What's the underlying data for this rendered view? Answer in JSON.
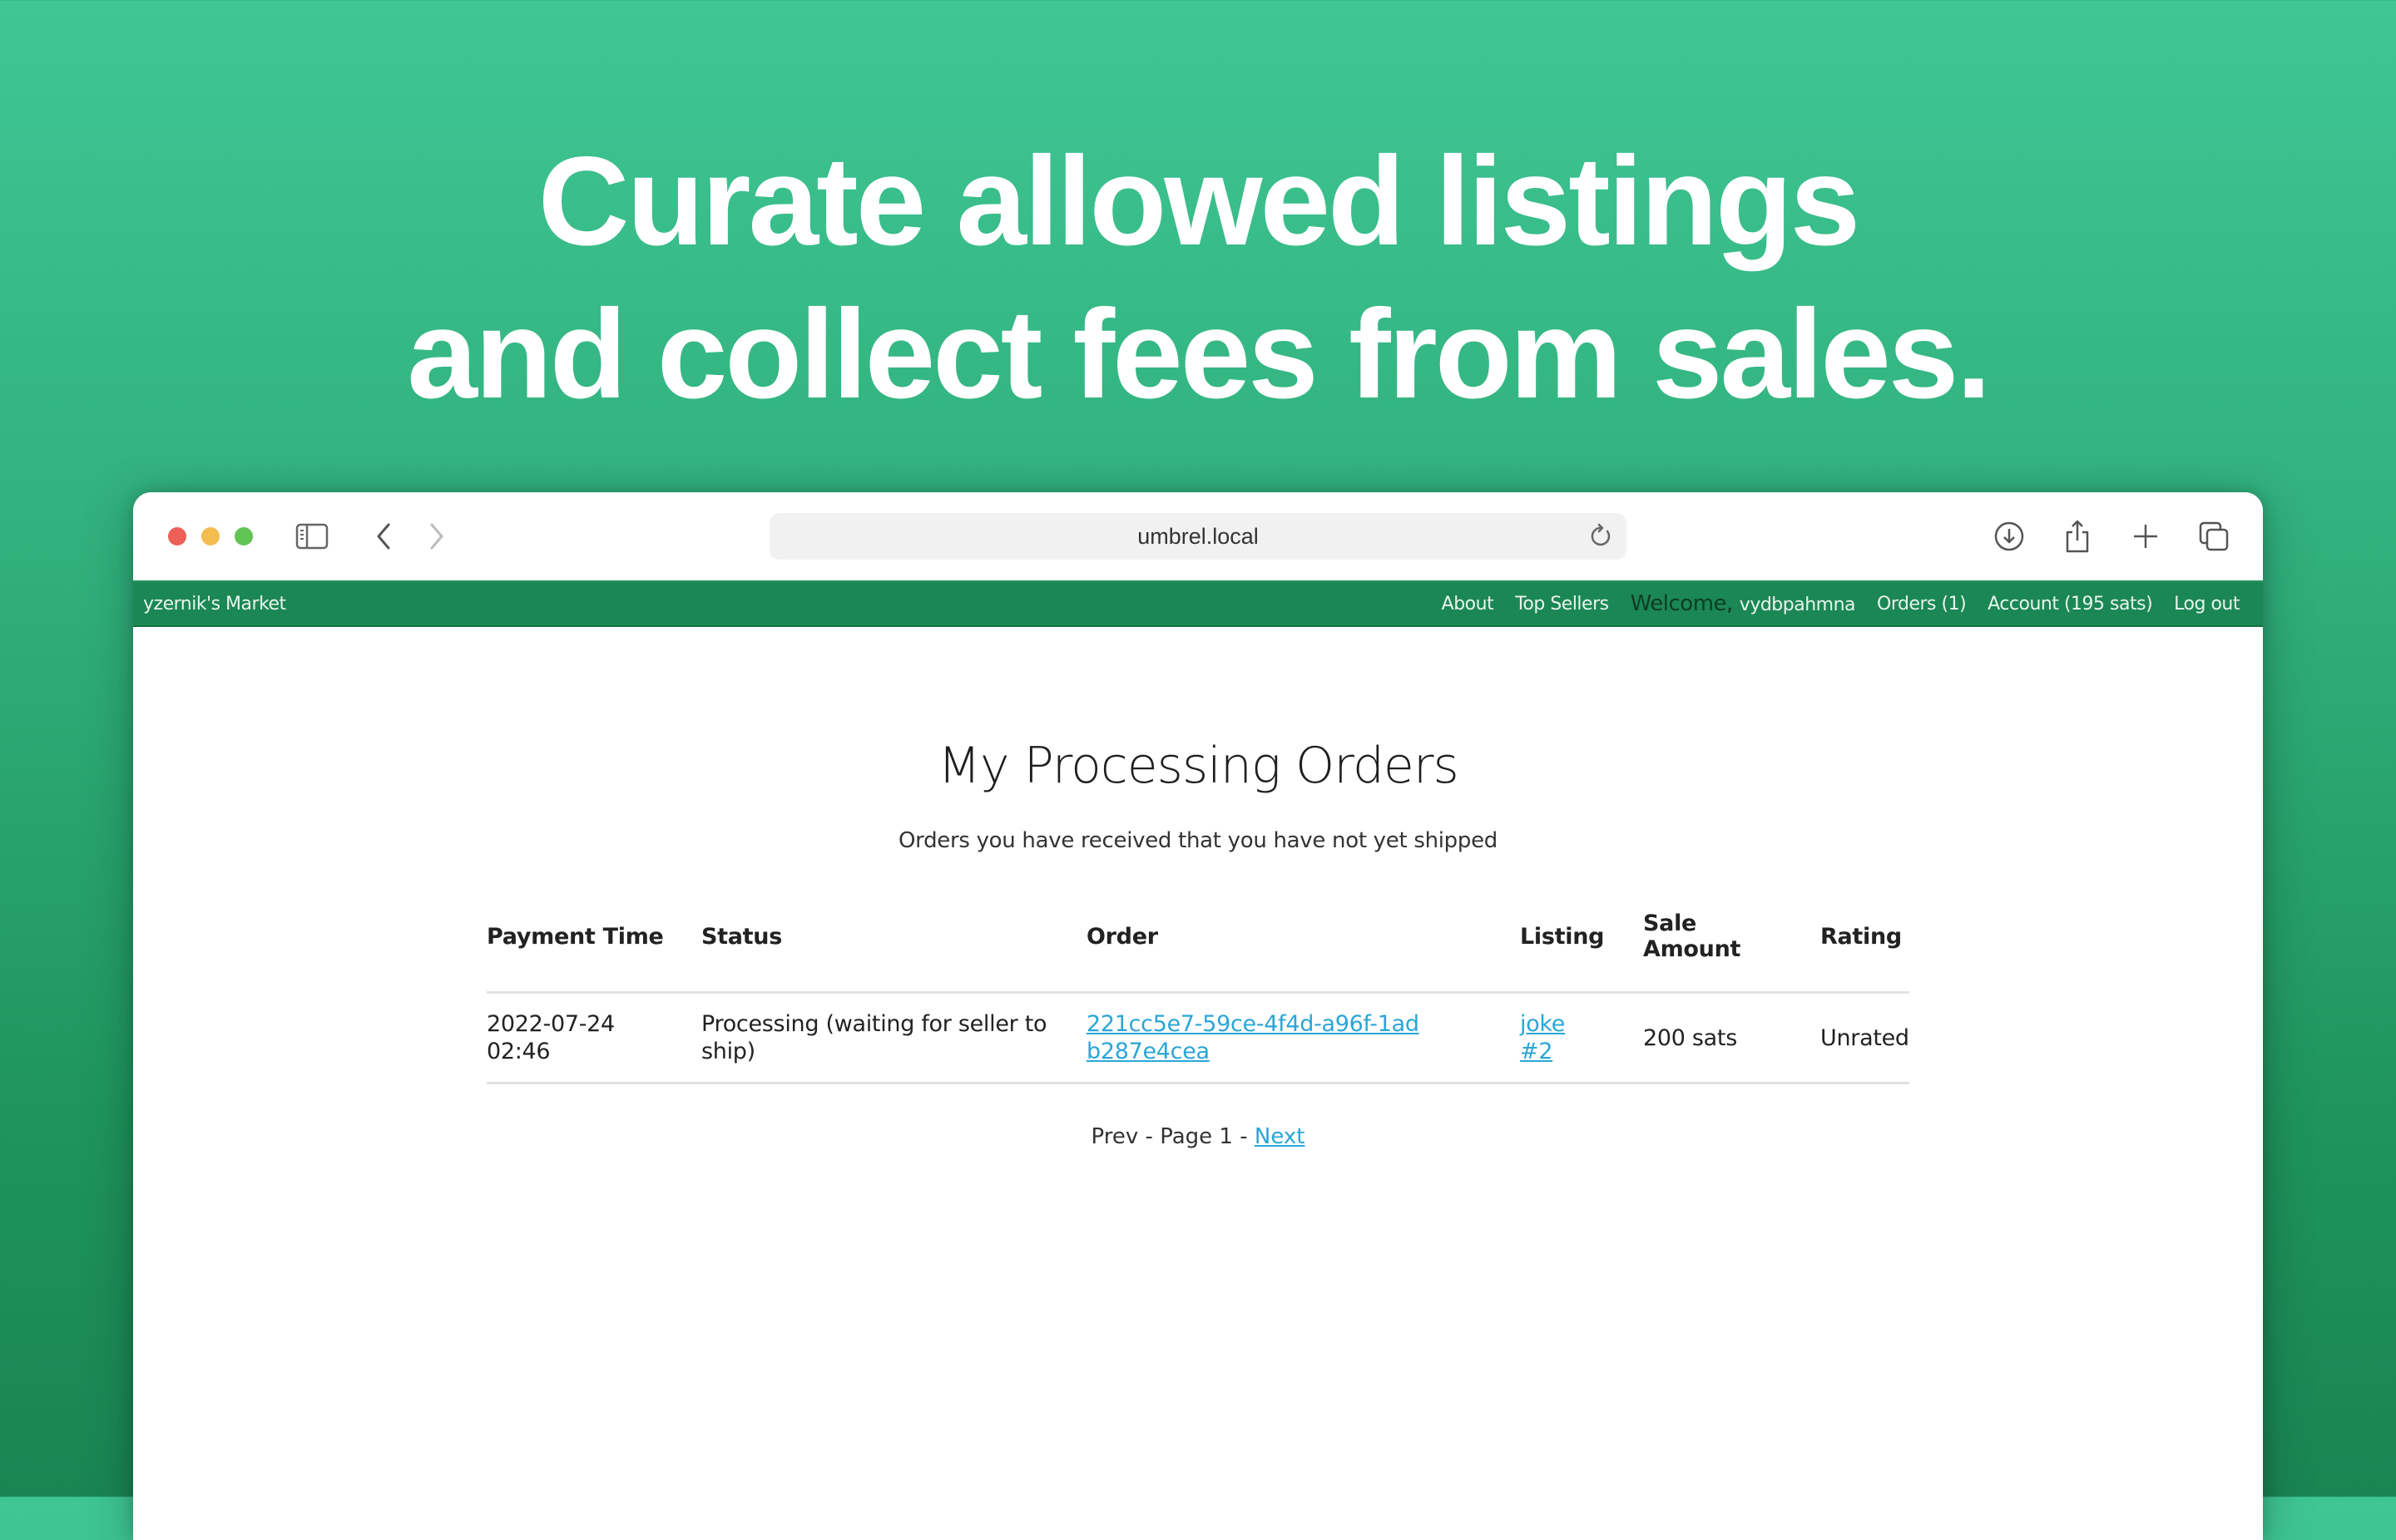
{
  "headline": {
    "line1": "Curate allowed listings",
    "line2": "and collect fees from sales."
  },
  "browser": {
    "url": "umbrel.local",
    "icons": [
      "sidebar-icon",
      "back-icon",
      "forward-icon",
      "reload-icon",
      "download-icon",
      "share-icon",
      "new-tab-icon",
      "tabs-overview-icon"
    ]
  },
  "nav": {
    "brand": "yzernik's Market",
    "about": "About",
    "top_sellers": "Top Sellers",
    "welcome_label": "Welcome,",
    "username": "vydbpahmna",
    "orders": "Orders (1)",
    "account": "Account (195 sats)",
    "logout": "Log out"
  },
  "page": {
    "title": "My Processing Orders",
    "subtitle": "Orders you have received that you have not yet shipped"
  },
  "table": {
    "headers": {
      "payment_time": "Payment Time",
      "status": "Status",
      "order": "Order",
      "listing": "Listing",
      "sale_amount": "Sale Amount",
      "rating": "Rating"
    },
    "rows": [
      {
        "payment_time": "2022-07-24 02:46",
        "status": "Processing (waiting for seller to ship)",
        "order": "221cc5e7-59ce-4f4d-a96f-1adb287e4cea",
        "listing": "joke #2",
        "sale_amount": "200 sats",
        "rating": "Unrated"
      }
    ]
  },
  "pagination": {
    "prev": "Prev",
    "separator": " - ",
    "page_label": "Page 1",
    "next": "Next"
  },
  "colors": {
    "nav_green": "#1b8754",
    "link_blue": "#2aa6d6",
    "background_top": "#3fc695",
    "background_bottom": "#1a8552"
  }
}
